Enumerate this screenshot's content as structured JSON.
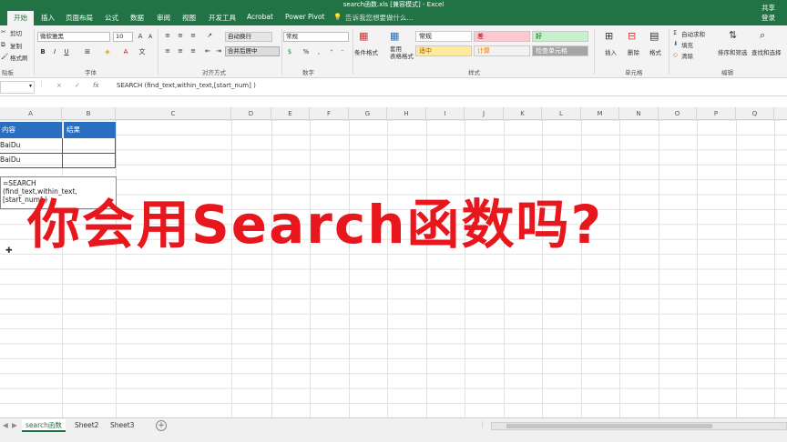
{
  "title_bar": {
    "text": "search函数.xls [兼容模式] - Excel"
  },
  "menu": {
    "tabs": [
      "开始",
      "插入",
      "页面布局",
      "公式",
      "数据",
      "审阅",
      "视图",
      "开发工具",
      "Acrobat",
      "Power Pivot"
    ],
    "tell_me": "告诉我您想要做什么...",
    "login": "登录",
    "share": "共享"
  },
  "ribbon": {
    "clipboard": {
      "cut": "剪切",
      "copy": "复制",
      "format_painter": "格式刷",
      "label": "贴板"
    },
    "font": {
      "name": "微软雅黑",
      "size": "10",
      "label": "字体",
      "bold": "B",
      "italic": "I",
      "underline": "U"
    },
    "alignment": {
      "wrap": "自动换行",
      "merge": "合并后居中",
      "label": "对齐方式"
    },
    "number": {
      "format": "常规",
      "label": "数字"
    },
    "styles": {
      "conditional": "条件格式",
      "table": "套用\n表格格式",
      "cells": [
        "常规",
        "差",
        "好",
        "适中",
        "计算",
        "检查单元格"
      ],
      "label": "样式"
    },
    "cells_group": {
      "insert": "插入",
      "delete": "删除",
      "format": "格式",
      "label": "单元格"
    },
    "editing": {
      "autosum": "自动求和",
      "fill": "填充",
      "clear": "清除",
      "sort": "排序和筛选",
      "find": "查找和选择",
      "label": "编辑"
    }
  },
  "formula_bar": {
    "cancel": "×",
    "enter": "✓",
    "fx": "fx",
    "formula": "SEARCH (find_text,within_text,[start_num] )"
  },
  "sheet": {
    "columns": [
      "A",
      "B",
      "C",
      "D",
      "E",
      "F",
      "G",
      "H",
      "I",
      "J",
      "K",
      "L",
      "M",
      "N",
      "O",
      "P",
      "Q"
    ],
    "header_a": "内容",
    "header_b": "结果",
    "row2_a": "BaiDu",
    "row3_a": "BaiDu",
    "tooltip_line1": "=SEARCH",
    "tooltip_line2": "(find_text,within_text,[start_num] )"
  },
  "overlay_text": "你会用Search函数吗?",
  "tabs_bottom": [
    "search函数",
    "Sheet2",
    "Sheet3"
  ],
  "colors": {
    "excel_green": "#217346",
    "header_blue": "#2a6fbf",
    "overlay_red": "#e8161d"
  }
}
